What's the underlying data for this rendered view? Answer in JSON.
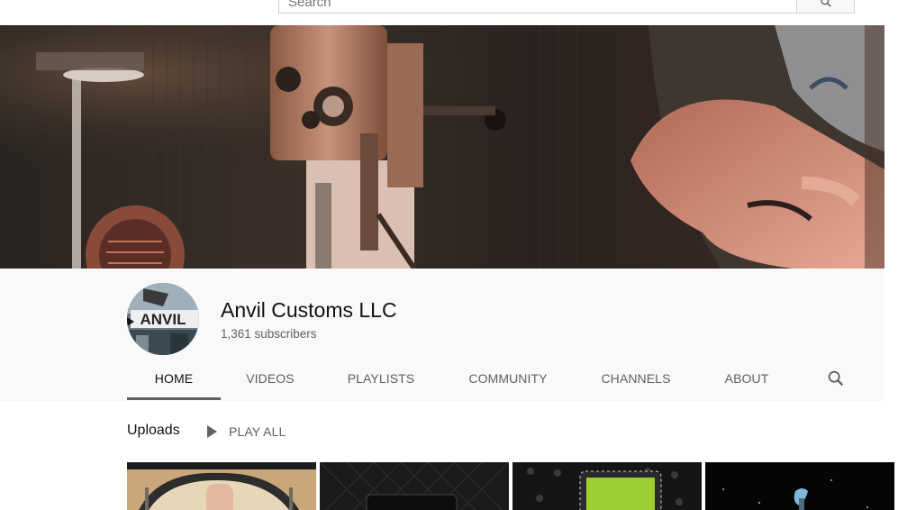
{
  "search": {
    "placeholder": "Search"
  },
  "channel": {
    "name": "Anvil Customs LLC",
    "subscribers": "1,361 subscribers",
    "avatar_text": "ANVIL"
  },
  "tabs": [
    {
      "label": "HOME",
      "active": true
    },
    {
      "label": "VIDEOS"
    },
    {
      "label": "PLAYLISTS"
    },
    {
      "label": "COMMUNITY"
    },
    {
      "label": "CHANNELS"
    },
    {
      "label": "ABOUT"
    }
  ],
  "uploads": {
    "title": "Uploads",
    "play_all_label": "PLAY ALL"
  },
  "icons": {
    "search": "search-icon",
    "tab_search": "search-icon",
    "play": "play-icon"
  },
  "colors": {
    "accent_tab_underline": "#606060",
    "header_bg": "#f9f9f9",
    "text_primary": "#111111",
    "text_secondary": "#606060"
  }
}
